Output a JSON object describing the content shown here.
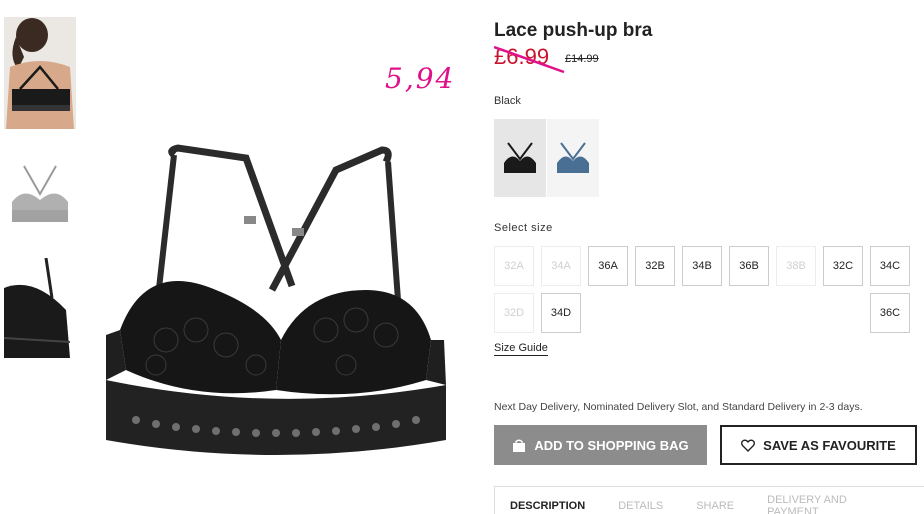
{
  "product": {
    "title": "Lace push-up bra",
    "price": "£6.99",
    "old_price": "£14.99",
    "price_color": "#c8142d"
  },
  "annotation": {
    "text": "5,94",
    "color": "#e0108a"
  },
  "colors": {
    "selected_label": "Black",
    "swatches": [
      {
        "name": "black",
        "color": "#1a1a1a",
        "selected": true
      },
      {
        "name": "blue",
        "color": "#4a6f94",
        "selected": false
      }
    ]
  },
  "sizes": {
    "label": "Select size",
    "options": [
      {
        "label": "32A",
        "available": false
      },
      {
        "label": "34A",
        "available": false
      },
      {
        "label": "36A",
        "available": true
      },
      {
        "label": "32B",
        "available": true
      },
      {
        "label": "34B",
        "available": true
      },
      {
        "label": "36B",
        "available": true
      },
      {
        "label": "38B",
        "available": false
      },
      {
        "label": "32C",
        "available": true
      },
      {
        "label": "34C",
        "available": true
      },
      {
        "label": "32D",
        "available": false
      },
      {
        "label": "34D",
        "available": true
      },
      {
        "label": "36C",
        "available": true
      }
    ],
    "guide_label": "Size Guide"
  },
  "delivery_text": "Next Day Delivery, Nominated Delivery Slot, and Standard Delivery in 2-3 days.",
  "actions": {
    "add_to_bag": "ADD TO SHOPPING BAG",
    "favourite": "SAVE AS FAVOURITE",
    "add_icon": "shopping-bag-icon",
    "fav_icon": "heart-icon",
    "add_bg": "#8c8c8c"
  },
  "tabs": [
    {
      "label": "DESCRIPTION",
      "active": true
    },
    {
      "label": "DETAILS",
      "active": false
    },
    {
      "label": "SHARE",
      "active": false
    },
    {
      "label": "DELIVERY AND PAYMENT",
      "active": false
    }
  ]
}
